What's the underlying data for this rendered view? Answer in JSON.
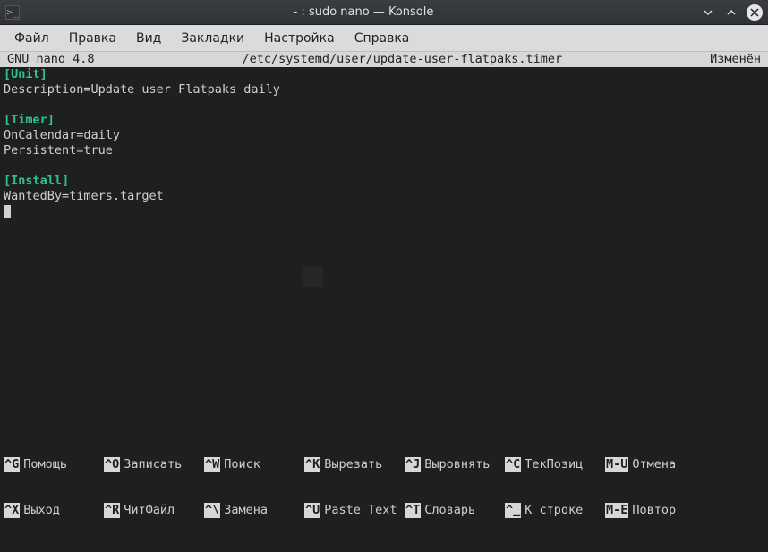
{
  "titlebar": {
    "app_icon": ">_",
    "title": "- : sudo nano — Konsole"
  },
  "menubar": {
    "items": [
      {
        "label": "Файл"
      },
      {
        "label": "Правка"
      },
      {
        "label": "Вид"
      },
      {
        "label": "Закладки"
      },
      {
        "label": "Настройка"
      },
      {
        "label": "Справка"
      }
    ]
  },
  "nano": {
    "version": "GNU nano 4.8",
    "filepath": "/etc/systemd/user/update-user-flatpaks.timer",
    "modified": "Изменён",
    "content": {
      "unit_header": "[Unit]",
      "unit_body": "Description=Update user Flatpaks daily",
      "timer_header": "[Timer]",
      "timer_body": "OnCalendar=daily\nPersistent=true",
      "install_header": "[Install]",
      "install_body": "WantedBy=timers.target"
    },
    "shortcuts_row1": [
      {
        "key": "^G",
        "label": "Помощь"
      },
      {
        "key": "^O",
        "label": "Записать"
      },
      {
        "key": "^W",
        "label": "Поиск"
      },
      {
        "key": "^K",
        "label": "Вырезать"
      },
      {
        "key": "^J",
        "label": "Выровнять"
      },
      {
        "key": "^C",
        "label": "ТекПозиц"
      },
      {
        "key": "M-U",
        "label": "Отмена"
      }
    ],
    "shortcuts_row2": [
      {
        "key": "^X",
        "label": "Выход"
      },
      {
        "key": "^R",
        "label": "ЧитФайл"
      },
      {
        "key": "^\\",
        "label": "Замена"
      },
      {
        "key": "^U",
        "label": "Paste Text"
      },
      {
        "key": "^T",
        "label": "Словарь"
      },
      {
        "key": "^_",
        "label": "К строке"
      },
      {
        "key": "M-E",
        "label": "Повтор"
      }
    ]
  }
}
